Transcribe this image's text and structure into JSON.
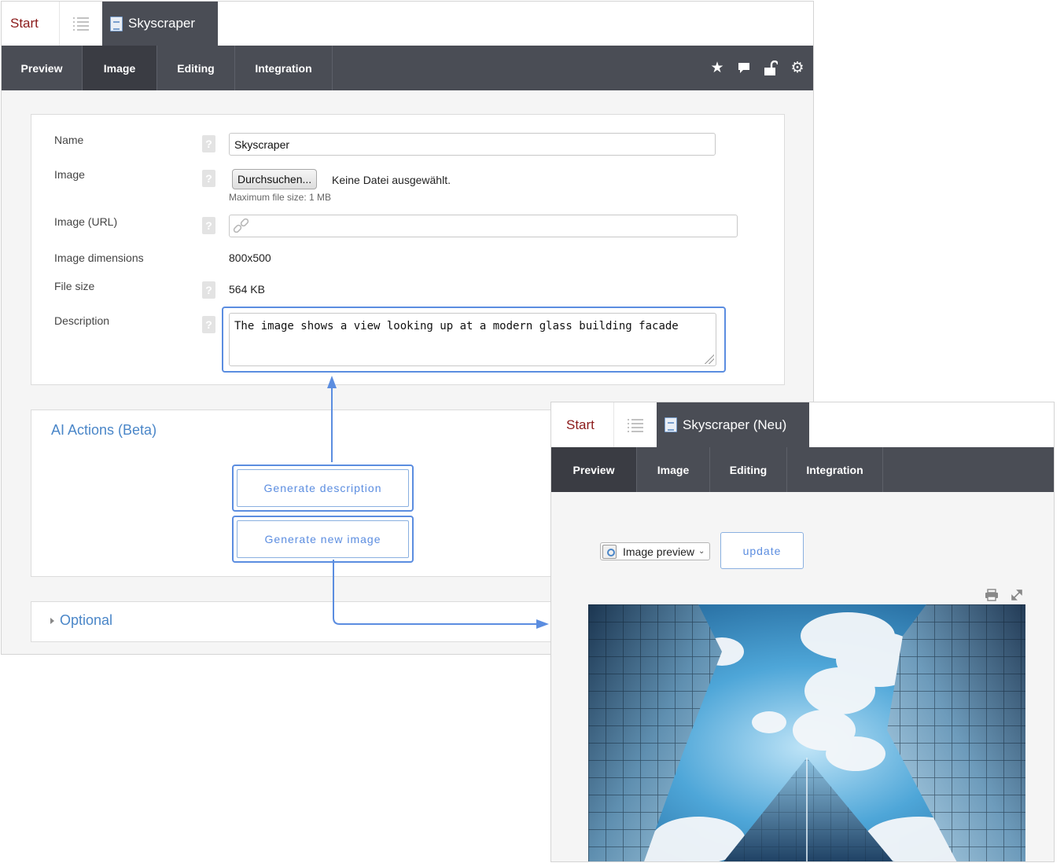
{
  "editor": {
    "tabs": {
      "start": "Start",
      "active": "Skyscraper"
    },
    "nav": [
      "Preview",
      "Image",
      "Editing",
      "Integration"
    ],
    "nav_icons": [
      "star-icon",
      "comment-icon",
      "unlock-icon",
      "gear-icon"
    ],
    "form": {
      "name_label": "Name",
      "name_value": "Skyscraper",
      "image_label": "Image",
      "browse_button": "Durchsuchen...",
      "no_file": "Keine Datei ausgewählt.",
      "max_size": "Maximum file size: 1 MB",
      "image_url_label": "Image (URL)",
      "image_url_value": "",
      "dimensions_label": "Image dimensions",
      "dimensions_value": "800x500",
      "file_size_label": "File size",
      "file_size_value": "564 KB",
      "description_label": "Description",
      "description_value": "The image shows a view looking up at a modern glass building facade",
      "help_glyph": "?"
    },
    "ai_actions": {
      "title": "AI Actions (Beta)",
      "generate_description": "Generate description",
      "generate_image": "Generate new image"
    },
    "optional_label": "Optional"
  },
  "preview_window": {
    "tabs": {
      "start": "Start",
      "active": "Skyscraper (Neu)"
    },
    "nav": [
      "Preview",
      "Image",
      "Editing",
      "Integration"
    ],
    "select_value": "Image preview",
    "update_button": "update",
    "tool_icons": [
      "print-icon",
      "expand-icon"
    ]
  },
  "colors": {
    "nav_bg": "#4a4d55",
    "accent_blue": "#5b8de0",
    "link_blue": "#4a86c8",
    "start_red": "#8b1a1a"
  }
}
